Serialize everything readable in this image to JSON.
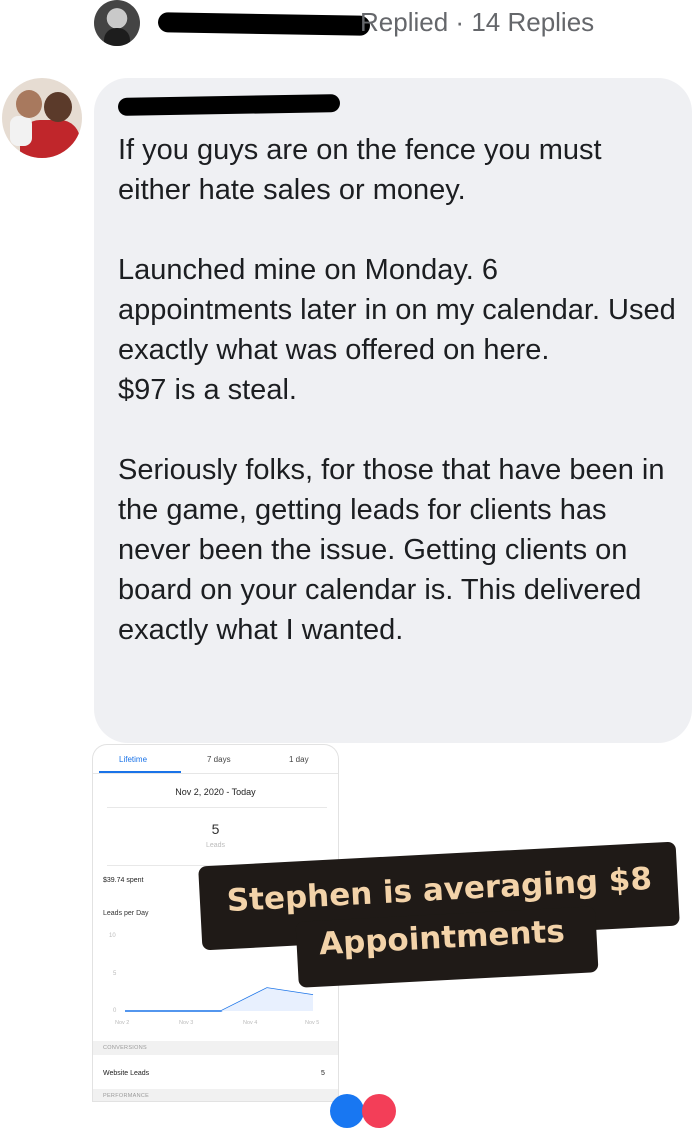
{
  "reply_header": {
    "replied_label": "Replied",
    "separator": "·",
    "replies_count": "14 Replies"
  },
  "comment": {
    "paragraphs": [
      "If you guys are on the fence you must either hate sales or money.",
      "Launched mine on Monday. 6 appointments later in on my calendar. Used exactly what was offered on here.",
      "$97 is a steal.",
      "Seriously folks, for those that have been in the game, getting leads for clients has never been the issue. Getting clients on board on your calendar is. This delivered exactly what I wanted."
    ]
  },
  "stats_screenshot": {
    "tabs": [
      "Lifetime",
      "7 days",
      "1 day"
    ],
    "active_tab": "Lifetime",
    "date_range": "Nov 2, 2020 - Today",
    "leads_value": "5",
    "leads_label": "Leads",
    "spent": "$39.74 spent",
    "chart_title": "Leads per Day",
    "y_ticks": [
      "10",
      "5",
      "0"
    ],
    "x_ticks": [
      "Nov 2",
      "Nov 3",
      "Nov 4",
      "Nov 5"
    ],
    "section_conversions": "CONVERSIONS",
    "website_leads_label": "Website Leads",
    "website_leads_value": "5",
    "section_performance": "PERFORMANCE",
    "line_color": "#1a73e8"
  },
  "overlay": {
    "line1": "Stephen is averaging $8",
    "line2": "Appointments",
    "bg_color": "#1f1a17",
    "text_color": "#f3d3a9"
  }
}
